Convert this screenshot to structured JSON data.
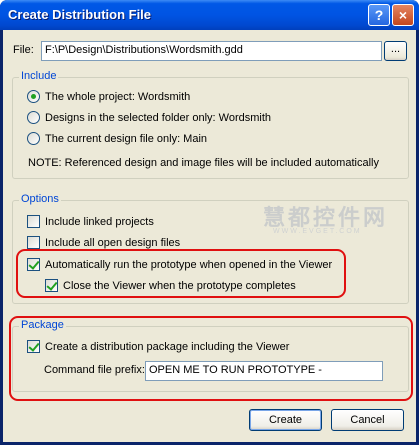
{
  "window": {
    "title": "Create Distribution File",
    "help_label": "?",
    "close_label": "×"
  },
  "file": {
    "label": "File:",
    "value": "F:\\P\\Design\\Distributions\\Wordsmith.gdd",
    "browse_label": "..."
  },
  "include": {
    "legend": "Include",
    "options": [
      {
        "label": "The whole project:  Wordsmith",
        "selected": true
      },
      {
        "label": "Designs in the selected folder only:  Wordsmith",
        "selected": false
      },
      {
        "label": "The current design file only:  Main",
        "selected": false
      }
    ],
    "note": "NOTE: Referenced design and image files will be included automatically"
  },
  "options": {
    "legend": "Options",
    "items": [
      {
        "label": "Include linked projects",
        "checked": false
      },
      {
        "label": "Include all open design files",
        "checked": false
      },
      {
        "label": "Automatically run the prototype when opened in the Viewer",
        "checked": true
      },
      {
        "label": "Close the Viewer when the prototype completes",
        "checked": true
      }
    ]
  },
  "package": {
    "legend": "Package",
    "create_label": "Create a distribution package including the Viewer",
    "create_checked": true,
    "prefix_label": "Command file prefix:",
    "prefix_value": "OPEN ME TO RUN PROTOTYPE -"
  },
  "buttons": {
    "create": "Create",
    "cancel": "Cancel"
  },
  "watermark": {
    "text": "慧都控件网",
    "sub": "WWW.EVGET.COM"
  },
  "colors": {
    "title_bar": "#0054e3",
    "legend_text": "#0046d5",
    "highlight_box": "#e01010",
    "check_mark": "#21a121"
  }
}
